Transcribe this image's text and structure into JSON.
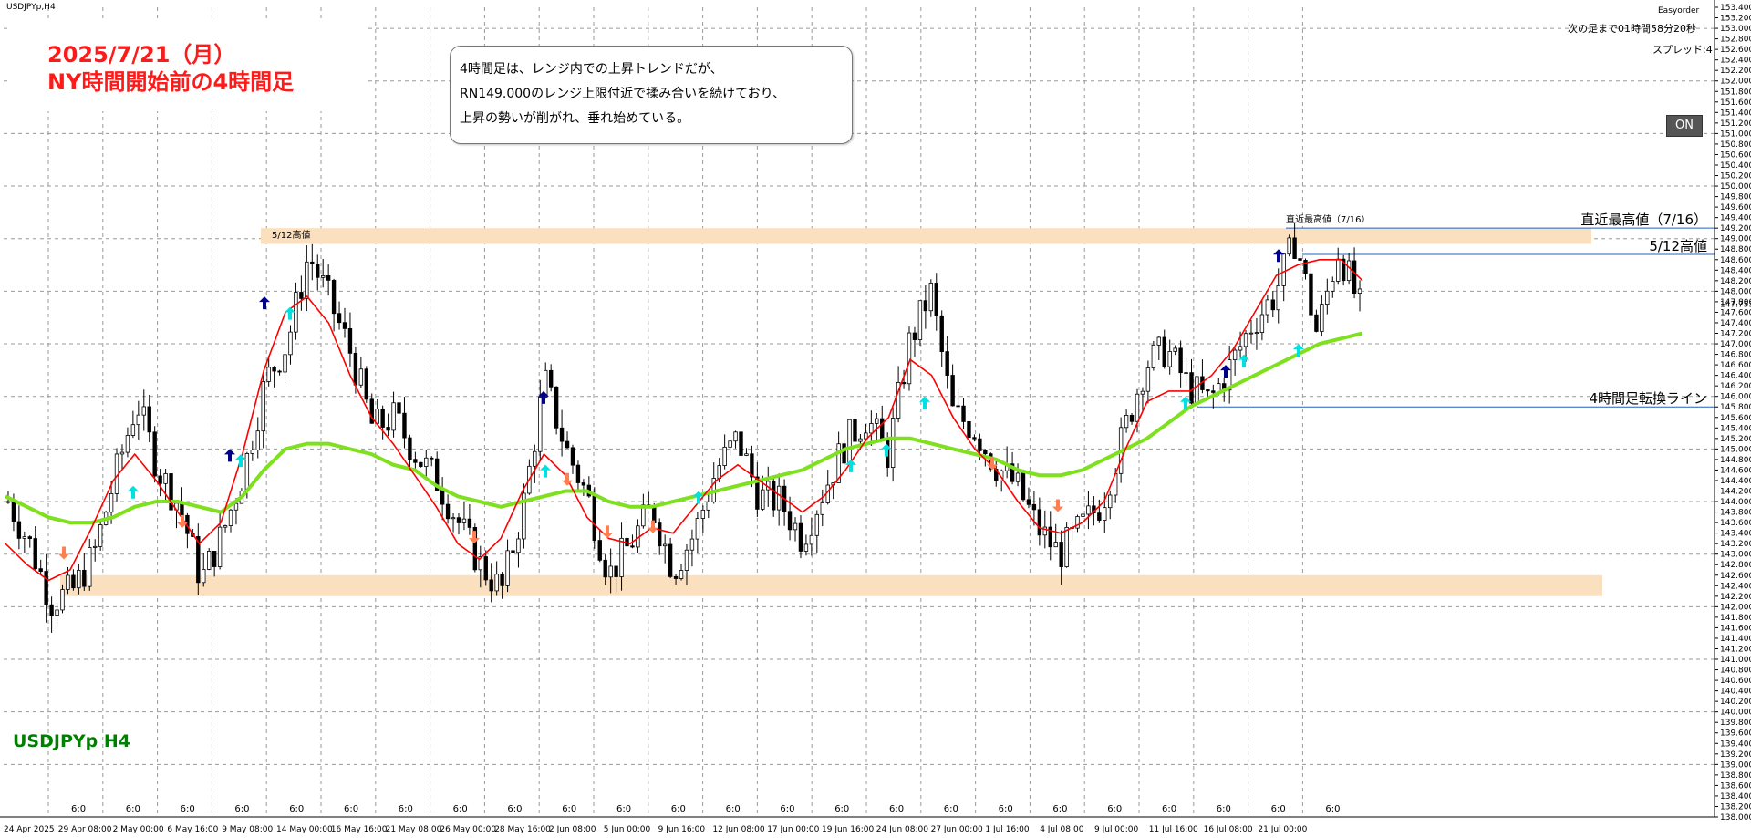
{
  "window": {
    "title": "USDJPYp,H4"
  },
  "symbol_label": "USDJPYp H4",
  "panel": {
    "easyorder": "Easyorder",
    "next_bar": "次の足まで01時間58分20秒",
    "spread": "スプレッド:4",
    "on_button": "ON"
  },
  "headline": {
    "line1": "2025/7/21（月）",
    "line2": "NY時間開始前の4時間足"
  },
  "callout": {
    "line1": "4時間足は、レンジ内での上昇トレンドだが、",
    "line2": "RN149.000のレンジ上限付近で揉み合いを続けており、",
    "line3": "上昇の勢いが削がれ、垂れ始めている。"
  },
  "colors": {
    "candle": "#000000",
    "ma_fast": "#ff0000",
    "ma_slow": "#7fe01f",
    "zone": "#fbe0c0",
    "hline": "#2060c0",
    "arrow_buy_strong": "#00008b",
    "arrow_buy": "#00e0e0",
    "arrow_sell": "#ff7f50"
  },
  "chart_data": {
    "type": "candlestick",
    "ylim": [
      138.0,
      153.4
    ],
    "y_ticks": [
      "153.400",
      "153.200",
      "153.000",
      "152.800",
      "152.600",
      "152.400",
      "152.200",
      "152.000",
      "151.800",
      "151.600",
      "151.400",
      "151.200",
      "151.000",
      "150.800",
      "150.600",
      "150.400",
      "150.200",
      "150.000",
      "149.800",
      "149.600",
      "149.400",
      "149.200",
      "149.000",
      "148.800",
      "148.600",
      "148.400",
      "148.200",
      "148.000",
      "147.800",
      "147.600",
      "147.400",
      "147.200",
      "147.000",
      "146.800",
      "146.600",
      "146.400",
      "146.200",
      "146.000",
      "145.800",
      "145.600",
      "145.400",
      "145.200",
      "145.000",
      "144.800",
      "144.600",
      "144.400",
      "144.200",
      "144.000",
      "143.800",
      "143.600",
      "143.400",
      "143.200",
      "143.000",
      "142.800",
      "142.600",
      "142.400",
      "142.200",
      "142.000",
      "141.800",
      "141.600",
      "141.400",
      "141.200",
      "141.000",
      "140.800",
      "140.600",
      "140.400",
      "140.200",
      "140.000",
      "139.800",
      "139.600",
      "139.400",
      "139.200",
      "139.000",
      "138.800",
      "138.600",
      "138.400",
      "138.200",
      "138.000"
    ],
    "current_price": "147.755",
    "x_labels": [
      "24 Apr 2025",
      "29 Apr 08:00",
      "2 May 00:00",
      "6 May 16:00",
      "9 May 08:00",
      "14 May 00:00",
      "16 May 16:00",
      "21 May 08:00",
      "26 May 00:00",
      "28 May 16:00",
      "2 Jun 08:00",
      "5 Jun 00:00",
      "9 Jun 16:00",
      "12 Jun 08:00",
      "17 Jun 00:00",
      "19 Jun 16:00",
      "24 Jun 08:00",
      "27 Jun 00:00",
      "1 Jul 16:00",
      "4 Jul 08:00",
      "9 Jul 00:00",
      "11 Jul 16:00",
      "16 Jul 08:00",
      "21 Jul 00:00"
    ],
    "session_labels": [
      "6:0",
      "6:0",
      "6:0",
      "6:0",
      "6:0",
      "6:0",
      "6:0",
      "6:0",
      "6:0",
      "6:0",
      "6:0",
      "6:0",
      "6:0",
      "6:0",
      "6:0",
      "6:0",
      "6:0",
      "6:0",
      "6:0",
      "6:0",
      "6:0",
      "6:0",
      "6:0",
      "6:0"
    ],
    "price_path": [
      144.0,
      143.2,
      142.1,
      142.3,
      143.0,
      144.5,
      145.9,
      144.6,
      143.9,
      142.5,
      143.4,
      144.6,
      146.3,
      147.0,
      148.7,
      147.8,
      146.8,
      145.4,
      145.6,
      144.9,
      144.4,
      143.6,
      142.8,
      142.3,
      143.9,
      146.3,
      145.0,
      144.1,
      142.6,
      143.2,
      143.9,
      142.7,
      143.4,
      144.6,
      145.2,
      144.1,
      144.0,
      143.3,
      144.2,
      145.1,
      145.6,
      144.9,
      147.0,
      148.0,
      145.7,
      145.4,
      144.7,
      144.3,
      143.5,
      143.0,
      143.5,
      144.0,
      145.3,
      146.6,
      146.9,
      146.2,
      145.9,
      146.6,
      147.4,
      147.9,
      149.0,
      147.2,
      148.8,
      147.7
    ],
    "series": [
      {
        "name": "",
        "kind": "ma_fast",
        "values": [
          143.2,
          142.8,
          142.5,
          142.7,
          143.5,
          144.4,
          144.9,
          144.4,
          143.8,
          143.2,
          143.6,
          144.9,
          146.5,
          147.6,
          147.9,
          147.4,
          146.4,
          145.6,
          145.1,
          144.5,
          143.9,
          143.2,
          142.9,
          143.3,
          144.2,
          144.9,
          144.5,
          143.7,
          143.3,
          143.2,
          143.5,
          143.4,
          143.9,
          144.4,
          144.7,
          144.4,
          144.1,
          143.8,
          144.1,
          144.6,
          145.2,
          145.6,
          146.7,
          146.4,
          145.6,
          145.0,
          144.6,
          144.0,
          143.5,
          143.4,
          143.6,
          144.0,
          145.0,
          145.9,
          146.1,
          146.1,
          146.4,
          146.9,
          147.6,
          148.3,
          148.5,
          148.6,
          148.6,
          148.2
        ]
      },
      {
        "name": "",
        "kind": "ma_slow",
        "values": [
          144.1,
          143.9,
          143.7,
          143.6,
          143.6,
          143.7,
          143.9,
          144.0,
          144.0,
          143.9,
          143.8,
          144.1,
          144.6,
          145.0,
          145.1,
          145.1,
          145.0,
          144.9,
          144.7,
          144.6,
          144.3,
          144.1,
          144.0,
          143.9,
          144.0,
          144.1,
          144.2,
          144.2,
          144.0,
          143.9,
          143.9,
          144.0,
          144.1,
          144.2,
          144.3,
          144.4,
          144.5,
          144.6,
          144.8,
          145.0,
          145.1,
          145.2,
          145.2,
          145.1,
          145.0,
          144.9,
          144.8,
          144.6,
          144.5,
          144.5,
          144.6,
          144.8,
          145.0,
          145.2,
          145.5,
          145.8,
          146.0,
          146.2,
          146.4,
          146.6,
          146.8,
          147.0,
          147.1,
          147.2
        ]
      }
    ],
    "zones": [
      {
        "label": "5/12高値",
        "from": 148.9,
        "to": 149.2
      },
      {
        "label": "",
        "from": 142.2,
        "to": 142.6
      }
    ],
    "lines": [
      {
        "label": "直近最高値（7/16）",
        "value": 149.2
      },
      {
        "label": "5/12高値",
        "value": 148.7
      },
      {
        "label": "4時間足転換ライン",
        "value": 145.8
      }
    ]
  }
}
